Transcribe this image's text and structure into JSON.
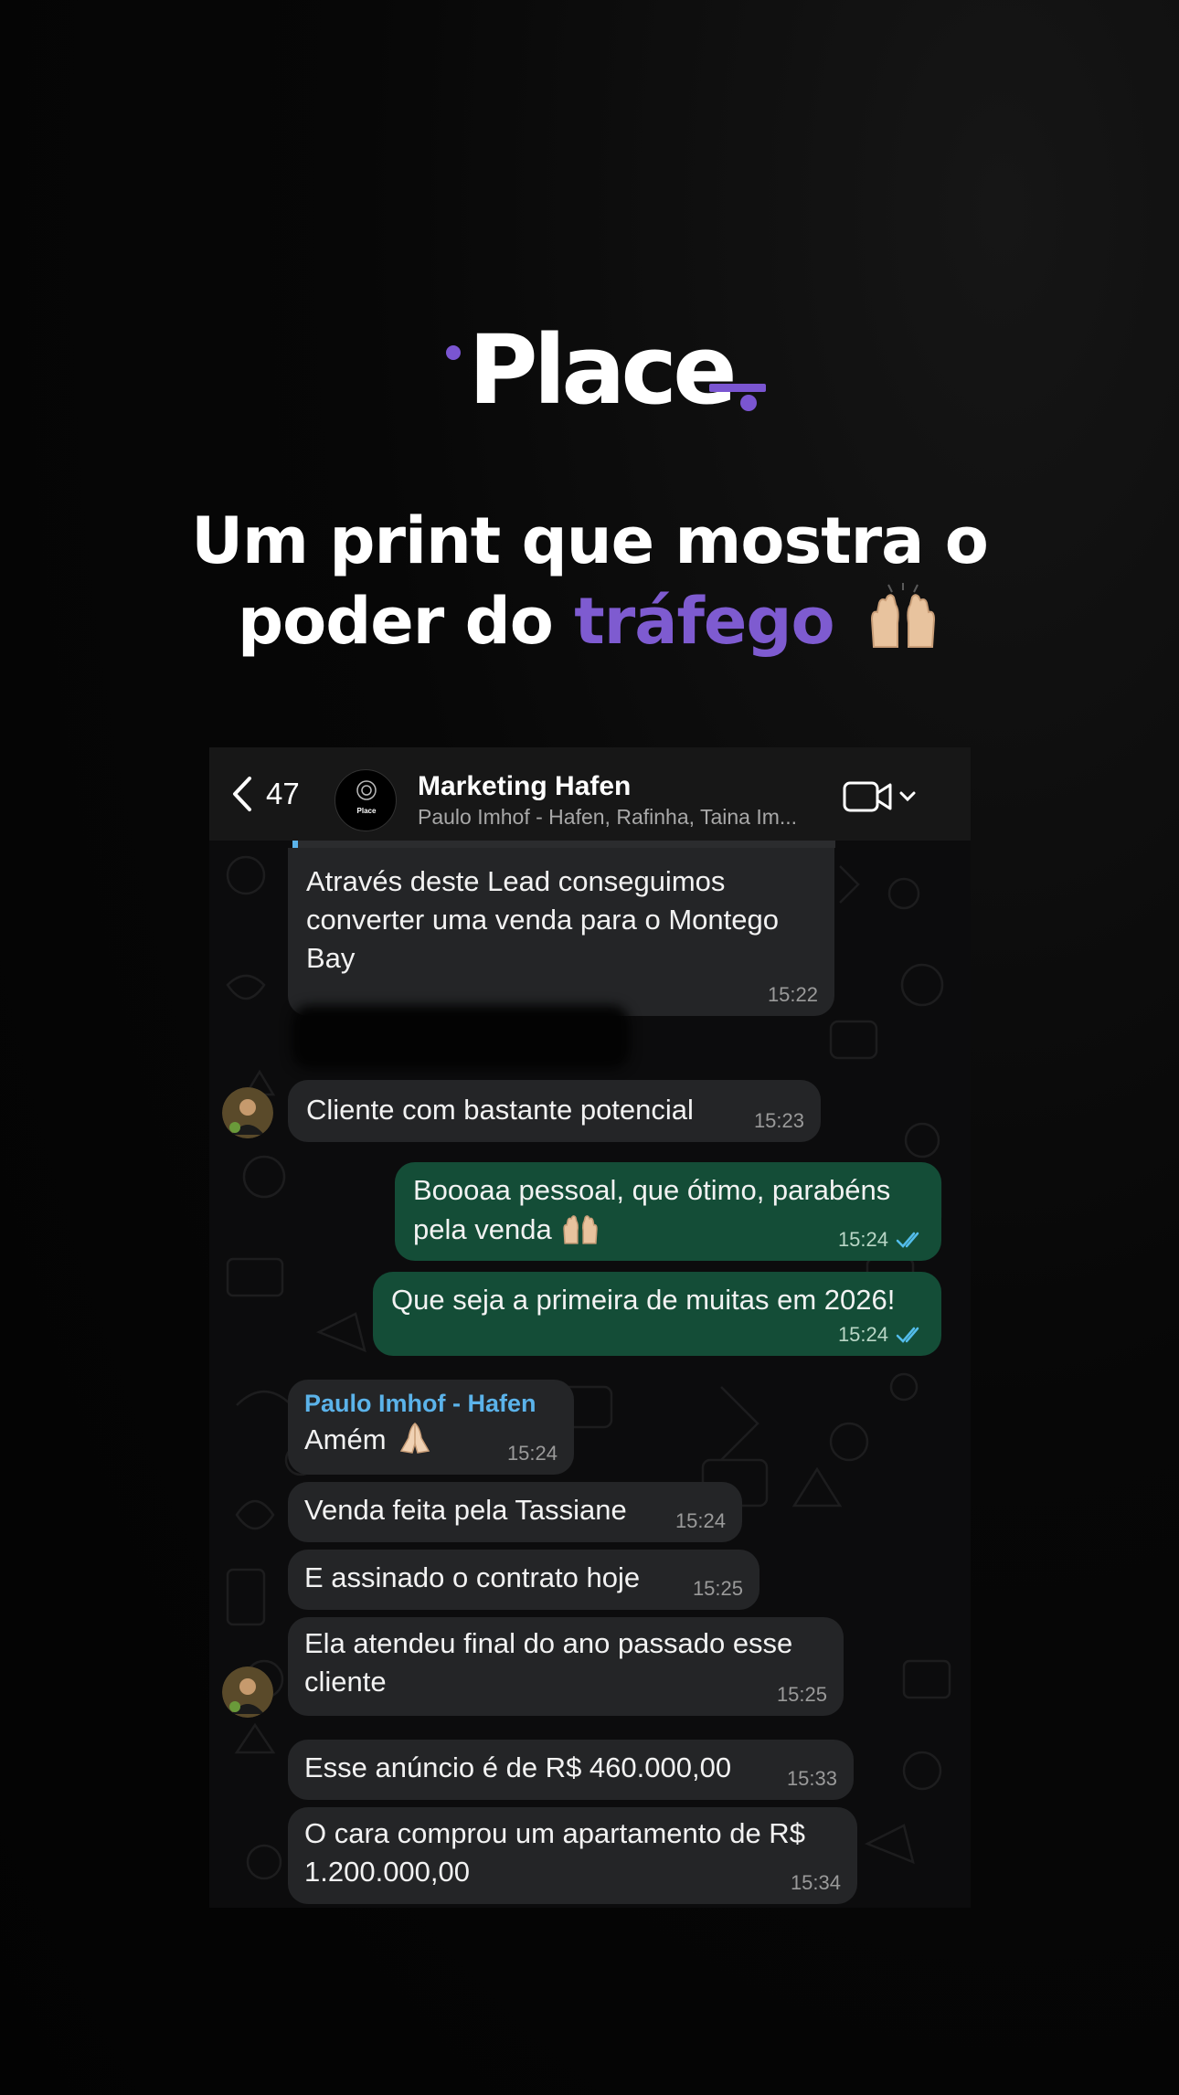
{
  "brand": {
    "logo_text": "Place",
    "accent_color": "#7a55d1"
  },
  "headline": {
    "line1": "Um print que mostra o",
    "line2_prefix": "poder do",
    "line2_accent": "tráfego",
    "emoji": "raising-hands-icon"
  },
  "chat": {
    "back_count": "47",
    "group_name": "Marketing Hafen",
    "members": "Paulo Imhof - Hafen, Rafinha, Taina Im...",
    "avatar_text": "Place",
    "messages": [
      {
        "dir": "in",
        "text": "Através deste Lead conseguimos converter uma venda para o Montego Bay",
        "time": "15:22"
      },
      {
        "dir": "in",
        "text": "Cliente com bastante potencial",
        "time": "15:23"
      },
      {
        "dir": "out",
        "text": "Boooaa pessoal, que ótimo, parabéns pela venda",
        "time": "15:24"
      },
      {
        "dir": "out",
        "text": "Que seja a primeira de muitas em 2026!",
        "time": "15:24"
      },
      {
        "dir": "in",
        "sender": "Paulo Imhof - Hafen",
        "text": "Amém",
        "time": "15:24"
      },
      {
        "dir": "in",
        "text": "Venda feita pela Tassiane",
        "time": "15:24"
      },
      {
        "dir": "in",
        "text": "E assinado o contrato hoje",
        "time": "15:25"
      },
      {
        "dir": "in",
        "text": "Ela atendeu final do ano passado esse cliente",
        "time": "15:25"
      },
      {
        "dir": "in",
        "text": "Esse anúncio é de R$ 460.000,00",
        "time": "15:33"
      },
      {
        "dir": "in",
        "text": "O cara comprou um apartamento de R$ 1.200.000,00",
        "time": "15:34"
      }
    ]
  },
  "colors": {
    "incoming_bubble": "#242527",
    "outgoing_bubble": "#144d37",
    "sender_name": "#5bb3ea",
    "read_ticks": "#53bdeb"
  }
}
